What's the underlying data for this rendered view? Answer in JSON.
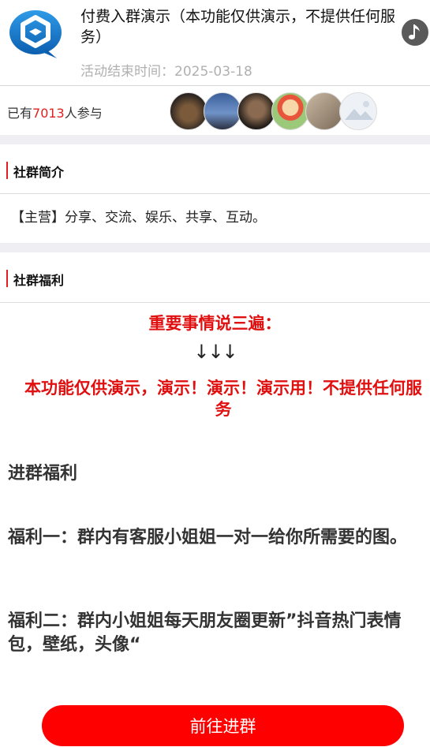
{
  "header": {
    "title": "付费入群演示（本功能仅供演示，不提供任何服务）",
    "end_time": "活动结束时间：2025-03-18"
  },
  "participants": {
    "prefix": "已有",
    "count": "7013",
    "suffix": "人参与",
    "avatars": [
      "avatar-dark-room",
      "avatar-sky",
      "avatar-person-sunglasses",
      "avatar-cartoon-boy",
      "avatar-girl",
      "avatar-placeholder-mountain"
    ]
  },
  "sections": {
    "intro_title": "社群简介",
    "intro_text": "【主营】分享、交流、娱乐、共享、互动。",
    "benefits_title": "社群福利"
  },
  "content": {
    "important": "重要事情说三遍：",
    "arrows": "↓↓↓",
    "notice": "本功能仅供演示，演示！演示！演示用！不提供任何服务",
    "join_benefit": "进群福利",
    "benefit1": "福利一：群内有客服小姐姐一对一给你所需要的图。",
    "benefit2": "福利二：群内小姐姐每天朋友圈更新”抖音热门表情包，壁纸，头像“"
  },
  "button": {
    "join": "前往进群"
  },
  "colors": {
    "accent_red": "#ff0000",
    "logo_blue": "#1a7fd4"
  }
}
